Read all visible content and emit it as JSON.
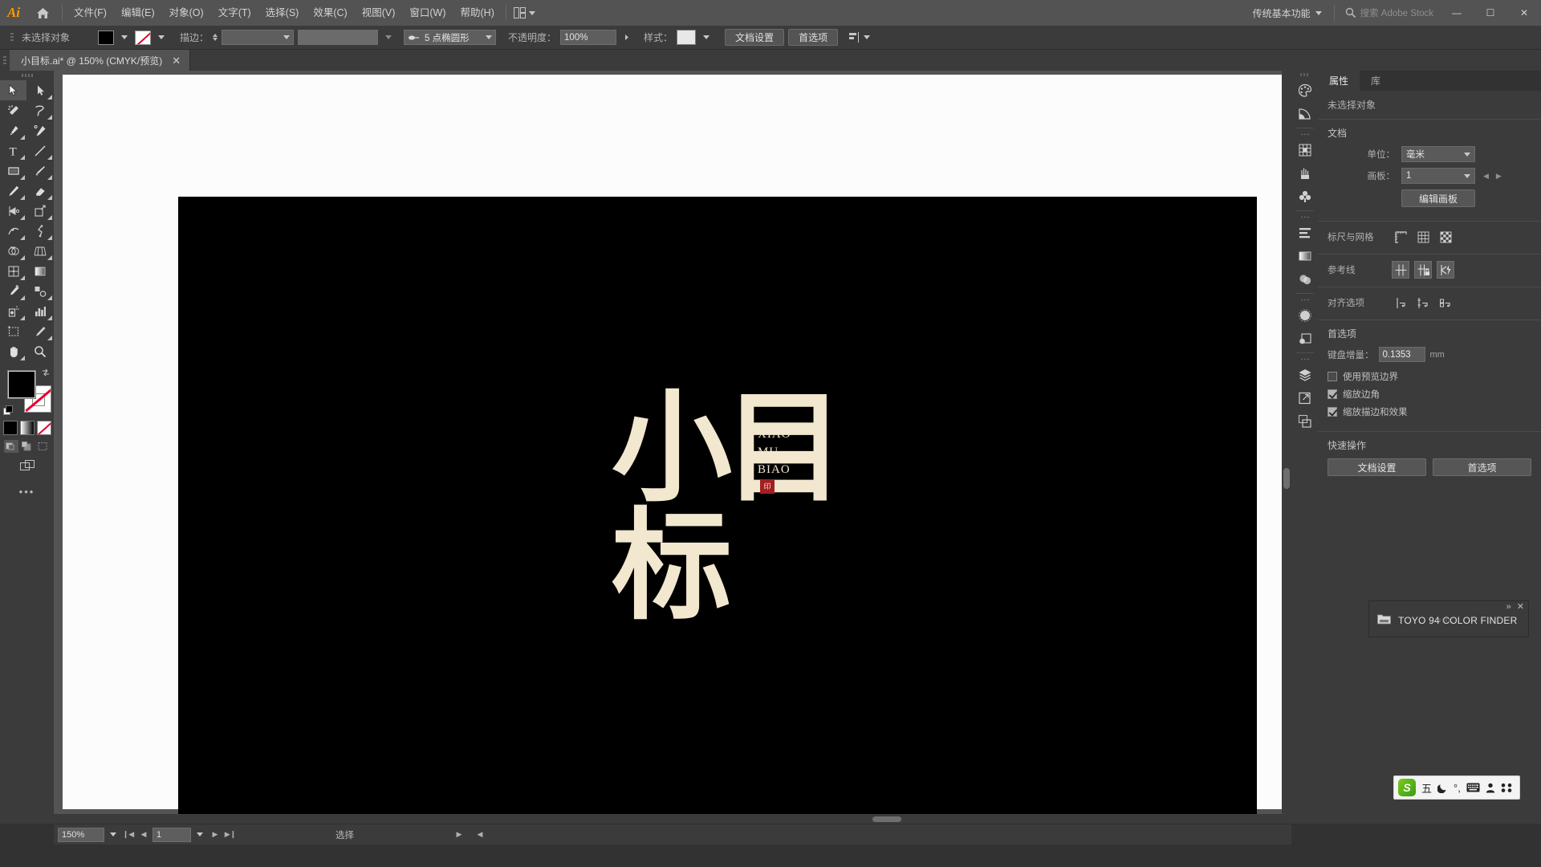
{
  "app": {
    "name": "Ai",
    "logo_color": "#ff9a00",
    "workspace": "传统基本功能",
    "search_placeholder": "搜索 Adobe Stock"
  },
  "menubar": {
    "items": [
      {
        "label": "文件(F)",
        "name": "menu-file"
      },
      {
        "label": "编辑(E)",
        "name": "menu-edit"
      },
      {
        "label": "对象(O)",
        "name": "menu-object"
      },
      {
        "label": "文字(T)",
        "name": "menu-type"
      },
      {
        "label": "选择(S)",
        "name": "menu-select"
      },
      {
        "label": "效果(C)",
        "name": "menu-effect"
      },
      {
        "label": "视图(V)",
        "name": "menu-view"
      },
      {
        "label": "窗口(W)",
        "name": "menu-window"
      },
      {
        "label": "帮助(H)",
        "name": "menu-help"
      }
    ],
    "home_icon": "home-icon",
    "arrange_icon": "arrange-documents-icon",
    "window_buttons": {
      "minimize": "—",
      "maximize": "☐",
      "close": "✕"
    }
  },
  "controlbar": {
    "selection_status": "未选择对象",
    "fill_label": "fill-swatch",
    "fill_color": "#000000",
    "stroke_label": "stroke-swatch",
    "stroke_color": "none",
    "stroke_text": "描边：",
    "stroke_weight": "",
    "brush_def": "5 点椭圆形",
    "opacity_label": "不透明度：",
    "opacity_value": "100%",
    "style_label": "样式：",
    "doc_setup": "文档设置",
    "preferences": "首选项"
  },
  "tabbar": {
    "tab_title": "小目标.ai* @ 150% (CMYK/预览)",
    "close_glyph": "✕"
  },
  "toolbar": {
    "tools": [
      {
        "name": "selection-tool",
        "label": "选择工具"
      },
      {
        "name": "direct-selection-tool",
        "label": "直接选择工具"
      },
      {
        "name": "magic-wand-tool",
        "label": "魔棒工具"
      },
      {
        "name": "lasso-tool",
        "label": "套索工具"
      },
      {
        "name": "pen-tool",
        "label": "钢笔工具"
      },
      {
        "name": "curvature-tool",
        "label": "曲率工具"
      },
      {
        "name": "type-tool",
        "label": "文字工具"
      },
      {
        "name": "line-segment-tool",
        "label": "直线段工具"
      },
      {
        "name": "rectangle-tool",
        "label": "矩形工具"
      },
      {
        "name": "paintbrush-tool",
        "label": "画笔工具"
      },
      {
        "name": "pencil-tool",
        "label": "铅笔工具"
      },
      {
        "name": "eraser-tool",
        "label": "橡皮擦工具"
      },
      {
        "name": "rotate-tool",
        "label": "旋转工具"
      },
      {
        "name": "scale-tool",
        "label": "比例缩放工具"
      },
      {
        "name": "width-tool",
        "label": "宽度工具"
      },
      {
        "name": "free-transform-tool",
        "label": "自由变换工具"
      },
      {
        "name": "shape-builder-tool",
        "label": "形状生成器工具"
      },
      {
        "name": "perspective-grid-tool",
        "label": "透视网格工具"
      },
      {
        "name": "mesh-tool",
        "label": "网格工具"
      },
      {
        "name": "gradient-tool",
        "label": "渐变工具"
      },
      {
        "name": "eyedropper-tool",
        "label": "吸管工具"
      },
      {
        "name": "blend-tool",
        "label": "混合工具"
      },
      {
        "name": "symbol-sprayer-tool",
        "label": "符号喷枪工具"
      },
      {
        "name": "column-graph-tool",
        "label": "柱形图工具"
      },
      {
        "name": "artboard-tool",
        "label": "画板工具"
      },
      {
        "name": "slice-tool",
        "label": "切片工具"
      },
      {
        "name": "hand-tool",
        "label": "抓手工具"
      },
      {
        "name": "zoom-tool",
        "label": "缩放工具"
      }
    ],
    "active_tool": "selection-tool",
    "fill_color": "#000000",
    "stroke_color": "none",
    "color_modes": [
      "color-swatch",
      "gradient-swatch",
      "none-swatch"
    ],
    "draw_modes": [
      "draw-normal",
      "draw-behind",
      "draw-inside"
    ],
    "screen_mode": "screen-mode-icon",
    "more_glyph": "•••"
  },
  "canvas": {
    "artboard_bg": "#000000",
    "art_text_color": "#f2e7cf",
    "art_chinese": "小目标",
    "pinyin": [
      "XIAO",
      "MU",
      "BIAO"
    ],
    "seal_color": "#a31f21",
    "seal_text": "印",
    "cursor": "arrow-cursor"
  },
  "statusbar": {
    "zoom": "150%",
    "page": "1",
    "status_text": "选择",
    "first_glyph": "❙◀",
    "prev_glyph": "◀",
    "next_glyph": "▶",
    "last_glyph": "▶❙"
  },
  "icondock": {
    "icons": [
      {
        "name": "color-panel-icon"
      },
      {
        "name": "color-guide-icon"
      },
      {
        "name": "swatches-panel-icon"
      },
      {
        "name": "brushes-panel-icon"
      },
      {
        "name": "symbols-panel-icon"
      },
      {
        "name": "align-panel-icon"
      },
      {
        "name": "gradient-panel-icon"
      },
      {
        "name": "transparency-panel-icon"
      },
      {
        "name": "appearance-panel-icon"
      },
      {
        "name": "graphic-styles-icon"
      },
      {
        "name": "layers-panel-icon"
      },
      {
        "name": "export-panel-icon"
      },
      {
        "name": "artboards-panel-icon"
      }
    ]
  },
  "properties": {
    "tabs": [
      {
        "label": "属性",
        "name": "tab-properties",
        "active": true
      },
      {
        "label": "库",
        "name": "tab-libraries",
        "active": false
      }
    ],
    "selection_status": "未选择对象",
    "document": {
      "title": "文档",
      "unit_label": "单位：",
      "unit_value": "毫米",
      "artboard_label": "画板：",
      "artboard_value": "1",
      "edit_artboards": "编辑画板"
    },
    "rulers": {
      "title": "标尺与网格",
      "icons": [
        "rulers-icon",
        "grid-icon",
        "transparency-grid-icon"
      ]
    },
    "guides": {
      "title": "参考线",
      "icons": [
        "show-guides-icon",
        "lock-guides-icon",
        "smart-guides-icon"
      ]
    },
    "snap": {
      "title": "对齐选项",
      "icons": [
        "snap-to-point-icon",
        "snap-to-grid-icon",
        "snap-to-pixel-icon"
      ]
    },
    "prefs": {
      "title": "首选项",
      "keyboard_increment_label": "键盘增量：",
      "keyboard_increment_value": "0.1353",
      "keyboard_increment_unit": "mm",
      "checkboxes": [
        {
          "label": "使用预览边界",
          "checked": false,
          "name": "use-preview-bounds-checkbox"
        },
        {
          "label": "缩放边角",
          "checked": true,
          "name": "scale-corners-checkbox"
        },
        {
          "label": "缩放描边和效果",
          "checked": true,
          "name": "scale-strokes-effects-checkbox"
        }
      ]
    },
    "quick_actions": {
      "title": "快速操作",
      "buttons": [
        "文档设置",
        "首选项"
      ]
    }
  },
  "toyo_panel": {
    "title": "TOYO 94 COLOR FINDER",
    "collapse_glyph": "»",
    "close_glyph": "✕",
    "folder_icon": "folder-icon"
  },
  "ime": {
    "logo": "S",
    "items": [
      {
        "name": "ime-mode-wubi",
        "glyph": "五"
      },
      {
        "name": "ime-moon-icon",
        "glyph": "☾"
      },
      {
        "name": "ime-punctuation-icon",
        "glyph": "°,"
      },
      {
        "name": "ime-keyboard-icon",
        "glyph": "⌨"
      },
      {
        "name": "ime-user-icon",
        "glyph": "♟"
      },
      {
        "name": "ime-apps-icon",
        "glyph": "∷"
      }
    ]
  }
}
